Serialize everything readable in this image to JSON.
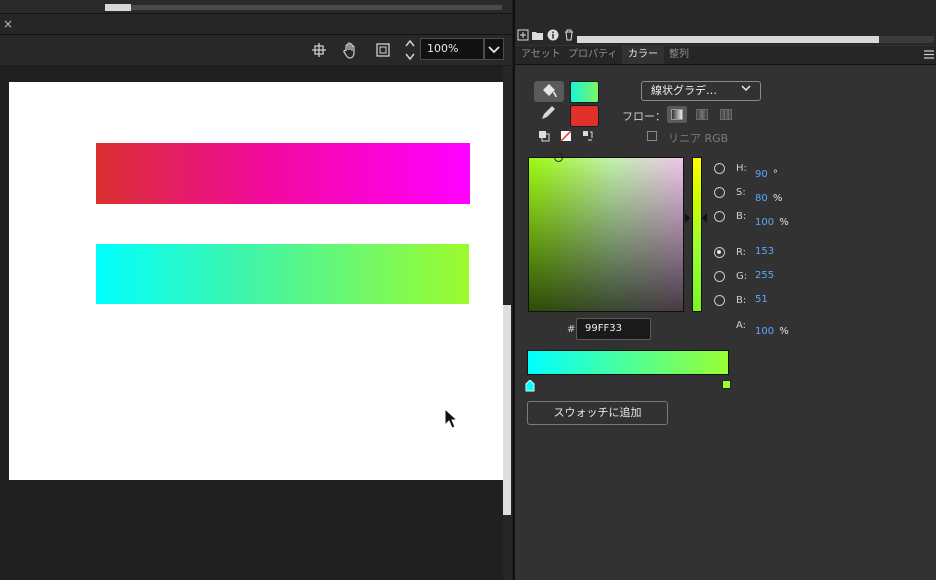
{
  "toolbar": {
    "zoom_value": "100%",
    "close_glyph": "×",
    "icons": [
      "crosshair-icon",
      "hand-icon",
      "frame-icon",
      "stepper-icon"
    ]
  },
  "canvas": {
    "bar1_colors": [
      "#d9302f",
      "#f20a9d",
      "#ff00ff"
    ],
    "bar2_colors": [
      "#00ffff",
      "#3ff5a9",
      "#9dfb2d"
    ]
  },
  "panel": {
    "tabs": [
      "アセット",
      "プロパティ",
      "カラー",
      "整列"
    ],
    "active_tab": "カラー",
    "fill_type": "線状グラデ…",
    "flow_label": "フロー：",
    "linear_rgb_label": "リニア RGB",
    "hsb": {
      "h_label": "H:",
      "h_value": "90",
      "h_unit": "°",
      "s_label": "S:",
      "s_value": "80",
      "s_unit": "%",
      "b_label": "B:",
      "b_value": "100",
      "b_unit": "%"
    },
    "rgb": {
      "r_label": "R:",
      "r_value": "153",
      "g_label": "G:",
      "g_value": "255",
      "b_label": "B:",
      "b_value": "51"
    },
    "alpha": {
      "label": "A:",
      "value": "100",
      "unit": "%"
    },
    "hex_prefix": "#",
    "hex_value": "99FF33",
    "add_swatch_label": "スウォッチに追加",
    "gradient_stops": [
      "#00ffff",
      "#99ff33"
    ],
    "stroke_color": "#e0302a"
  }
}
